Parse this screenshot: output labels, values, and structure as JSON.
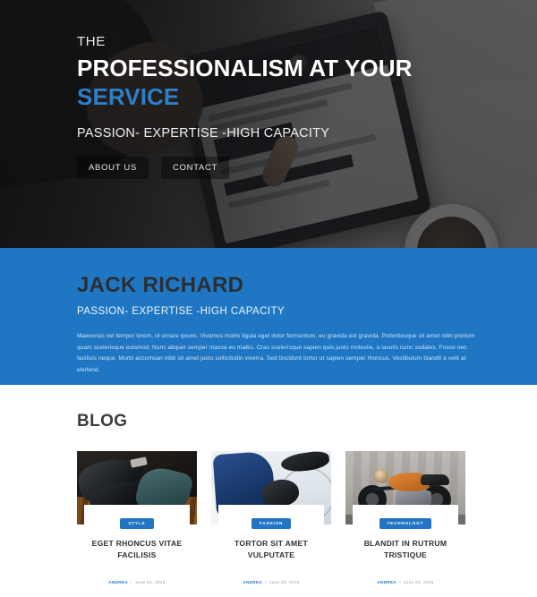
{
  "hero": {
    "eyebrow": "THE",
    "title_line1": "PROFESSIONALISM AT YOUR",
    "title_line2": "SERVICE",
    "subtitle": "PASSION- EXPERTISE -HIGH CAPACITY",
    "nav": [
      {
        "label": "ABOUT US"
      },
      {
        "label": "CONTACT"
      }
    ],
    "background_description": "hands using a tablet on a desk with papers and a coffee cup",
    "accent_color": "#2e7fc7",
    "overlay_color": "#101113"
  },
  "intro": {
    "name": "JACK RICHARD",
    "tagline": "PASSION- EXPERTISE -HIGH CAPACITY",
    "body": "Maecenas vel tempor lorem, id ornare ipsum. Vivamus mollis ligula eget dolor fermentum, eu gravida est gravida. Pellentesque sit amet nibh pretium quam scelerisque euismod. Nunc aliquet semper massa eu mattis. Cras scelerisque sapien quis justo molestie, a iaculis nunc sodales. Fusce nec facilisis neque. Morbi accumsan nibh sit amet justo sollicitudin viverra. Sed tincidunt tortor ut sapien semper rhoncus. Vestibulum blandit a velit at eleifend.",
    "background_color": "#1f77c4",
    "name_color": "#2b2f33"
  },
  "blog": {
    "section_title": "BLOG",
    "posts": [
      {
        "category": "STYLE",
        "title": "EGET RHONCUS VITAE FACILISIS",
        "author": "ANDREA",
        "separator": "•",
        "date": "June 20, 2016",
        "image_description": "black dress shoes and a teal necktie on rustic wood"
      },
      {
        "category": "FASHION",
        "title": "TORTOR SIT AMET VULPUTATE",
        "author": "ANDREA",
        "separator": "•",
        "date": "June 20, 2016",
        "image_description": "cyclist in a blue jersey holding a helmet next to a bicycle"
      },
      {
        "category": "TECHNOLOGY",
        "title": "BLANDIT IN RUTRUM TRISTIQUE",
        "author": "ANDREA",
        "separator": "•",
        "date": "June 20, 2016",
        "image_description": "orange cafe racer motorcycle in front of a concrete wall"
      }
    ],
    "badge_color": "#2175c4",
    "link_color": "#2175c4"
  }
}
